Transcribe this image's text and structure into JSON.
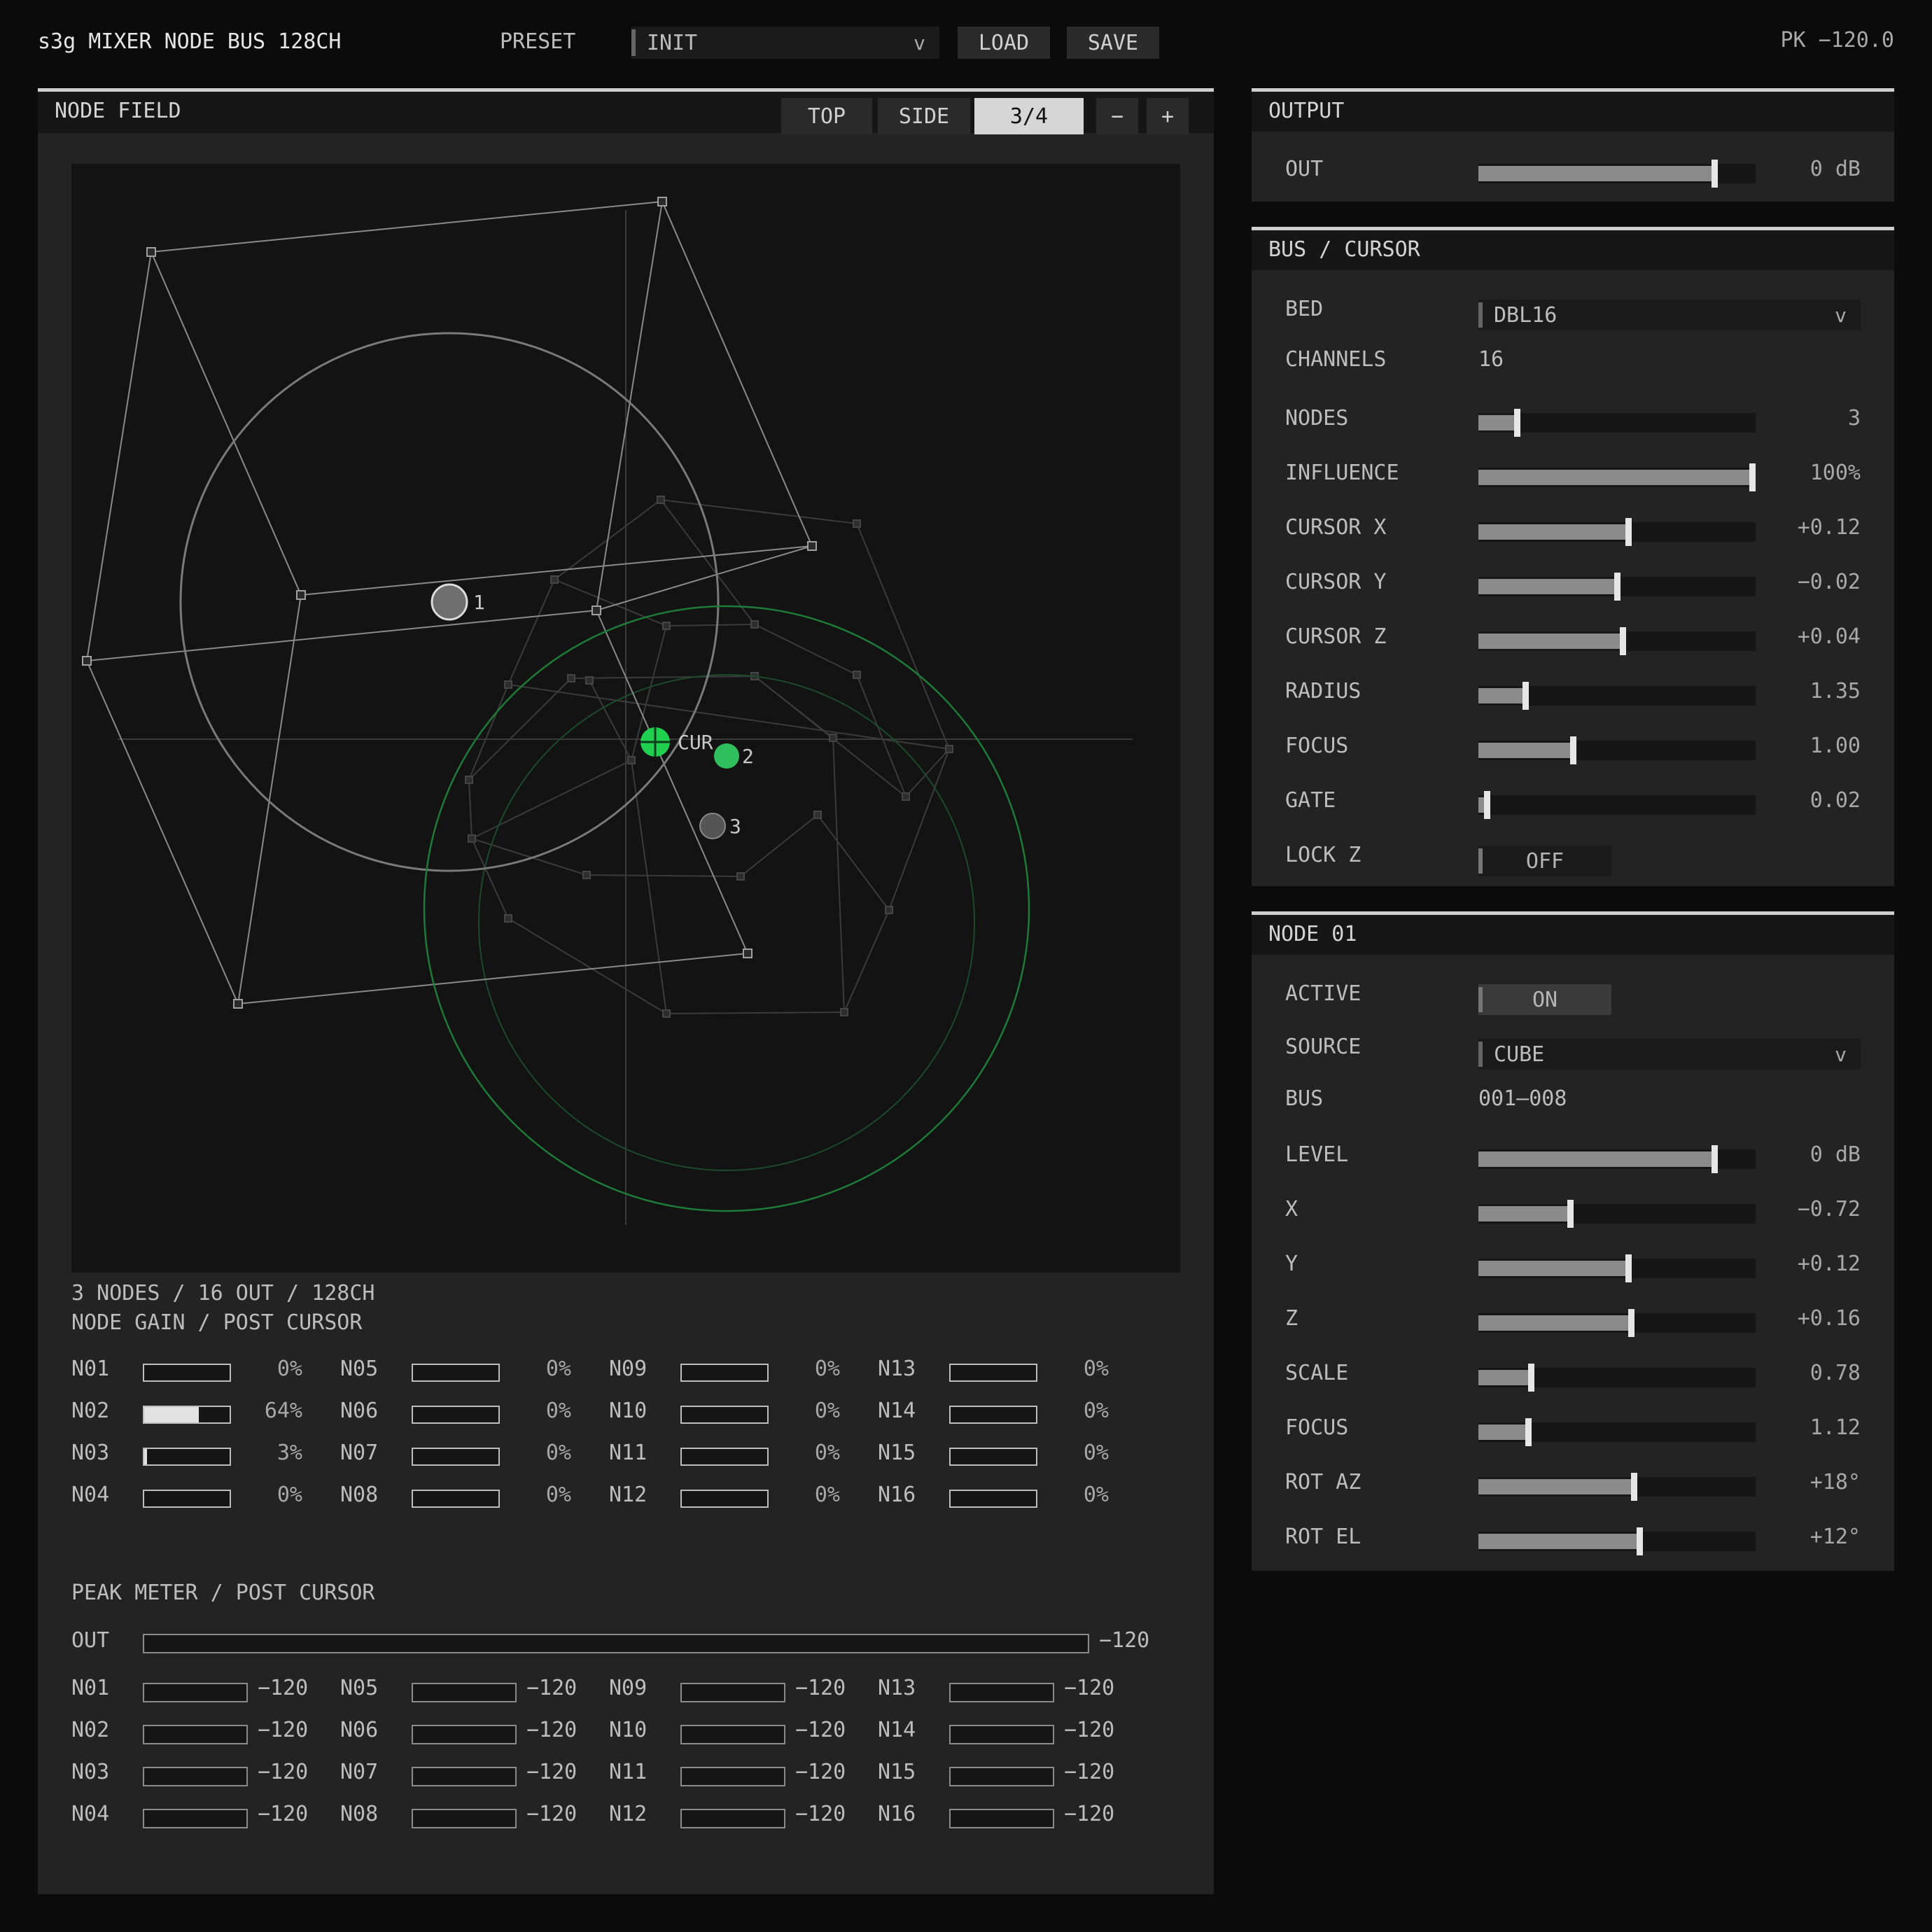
{
  "header": {
    "title": "s3g MIXER NODE BUS 128CH",
    "preset_label": "PRESET",
    "preset_value": "INIT",
    "load_label": "LOAD",
    "save_label": "SAVE",
    "peak_readout": "PK −120.0"
  },
  "node_field": {
    "title": "NODE FIELD",
    "views": [
      "TOP",
      "SIDE",
      "3/4"
    ],
    "active_view": "3/4",
    "zoom_out": "−",
    "zoom_in": "+",
    "cursor_label": "CUR",
    "node_labels": [
      "1",
      "2",
      "3"
    ],
    "summary": "3 NODES / 16 OUT / 128CH"
  },
  "node_gain": {
    "title": "NODE GAIN / POST CURSOR",
    "items": [
      {
        "name": "N01",
        "percent": 0,
        "value": "0%"
      },
      {
        "name": "N02",
        "percent": 64,
        "value": "64%"
      },
      {
        "name": "N03",
        "percent": 3,
        "value": "3%"
      },
      {
        "name": "N04",
        "percent": 0,
        "value": "0%"
      },
      {
        "name": "N05",
        "percent": 0,
        "value": "0%"
      },
      {
        "name": "N06",
        "percent": 0,
        "value": "0%"
      },
      {
        "name": "N07",
        "percent": 0,
        "value": "0%"
      },
      {
        "name": "N08",
        "percent": 0,
        "value": "0%"
      },
      {
        "name": "N09",
        "percent": 0,
        "value": "0%"
      },
      {
        "name": "N10",
        "percent": 0,
        "value": "0%"
      },
      {
        "name": "N11",
        "percent": 0,
        "value": "0%"
      },
      {
        "name": "N12",
        "percent": 0,
        "value": "0%"
      },
      {
        "name": "N13",
        "percent": 0,
        "value": "0%"
      },
      {
        "name": "N14",
        "percent": 0,
        "value": "0%"
      },
      {
        "name": "N15",
        "percent": 0,
        "value": "0%"
      },
      {
        "name": "N16",
        "percent": 0,
        "value": "0%"
      }
    ]
  },
  "peak_meter": {
    "title": "PEAK METER / POST CURSOR",
    "out_label": "OUT",
    "out_value": "−120",
    "items": [
      {
        "name": "N01",
        "value": "−120"
      },
      {
        "name": "N02",
        "value": "−120"
      },
      {
        "name": "N03",
        "value": "−120"
      },
      {
        "name": "N04",
        "value": "−120"
      },
      {
        "name": "N05",
        "value": "−120"
      },
      {
        "name": "N06",
        "value": "−120"
      },
      {
        "name": "N07",
        "value": "−120"
      },
      {
        "name": "N08",
        "value": "−120"
      },
      {
        "name": "N09",
        "value": "−120"
      },
      {
        "name": "N10",
        "value": "−120"
      },
      {
        "name": "N11",
        "value": "−120"
      },
      {
        "name": "N12",
        "value": "−120"
      },
      {
        "name": "N13",
        "value": "−120"
      },
      {
        "name": "N14",
        "value": "−120"
      },
      {
        "name": "N15",
        "value": "−120"
      },
      {
        "name": "N16",
        "value": "−120"
      }
    ]
  },
  "output": {
    "title": "OUTPUT",
    "out_label": "OUT",
    "out_fraction": 0.84,
    "out_value": "0 dB"
  },
  "bus_cursor": {
    "title": "BUS / CURSOR",
    "bed_label": "BED",
    "bed_value": "DBL16",
    "channels_label": "CHANNELS",
    "channels_value": "16",
    "sliders": [
      {
        "label": "NODES",
        "fraction": 0.13,
        "value": "3"
      },
      {
        "label": "INFLUENCE",
        "fraction": 0.99,
        "value": "100%"
      },
      {
        "label": "CURSOR X",
        "fraction": 0.53,
        "value": "+0.12"
      },
      {
        "label": "CURSOR Y",
        "fraction": 0.49,
        "value": "−0.02"
      },
      {
        "label": "CURSOR Z",
        "fraction": 0.51,
        "value": "+0.04"
      },
      {
        "label": "RADIUS",
        "fraction": 0.16,
        "value": "1.35"
      },
      {
        "label": "FOCUS",
        "fraction": 0.33,
        "value": "1.00"
      },
      {
        "label": "GATE",
        "fraction": 0.02,
        "value": "0.02"
      }
    ],
    "lockz_label": "LOCK Z",
    "lockz_value": "OFF"
  },
  "node01": {
    "title": "NODE 01",
    "active_label": "ACTIVE",
    "active_value": "ON",
    "source_label": "SOURCE",
    "source_value": "CUBE",
    "bus_label": "BUS",
    "bus_value": "001–008",
    "sliders": [
      {
        "label": "LEVEL",
        "fraction": 0.84,
        "value": "0 dB"
      },
      {
        "label": "X",
        "fraction": 0.32,
        "value": "−0.72"
      },
      {
        "label": "Y",
        "fraction": 0.53,
        "value": "+0.12"
      },
      {
        "label": "Z",
        "fraction": 0.54,
        "value": "+0.16"
      },
      {
        "label": "SCALE",
        "fraction": 0.18,
        "value": "0.78"
      },
      {
        "label": "FOCUS",
        "fraction": 0.17,
        "value": "1.12"
      },
      {
        "label": "ROT AZ",
        "fraction": 0.55,
        "value": "+18°"
      },
      {
        "label": "ROT EL",
        "fraction": 0.57,
        "value": "+12°"
      }
    ]
  },
  "colors": {
    "cursor_green": "#1fd14f",
    "node2_green": "#2fbf5c",
    "influence_ring": "#1e7a38"
  }
}
